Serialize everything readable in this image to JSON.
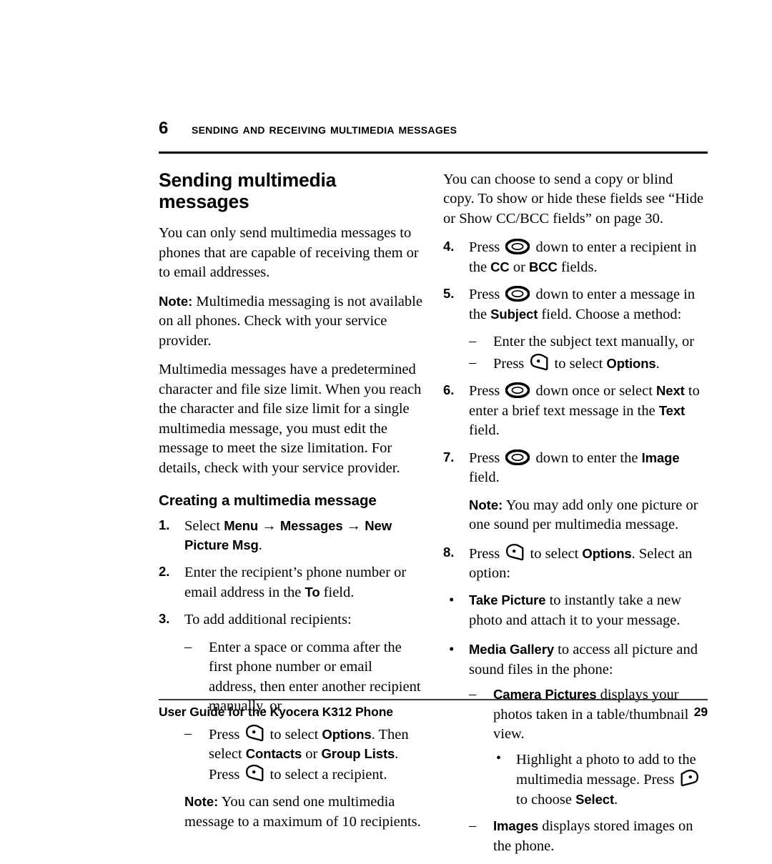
{
  "header": {
    "chapter_number": "6",
    "chapter_title": "Sending and Receiving Multimedia Messages"
  },
  "left_column": {
    "section_title": "Sending multimedia messages",
    "intro": "You can only send multimedia messages to phones that are capable of receiving them or to email addresses.",
    "note1_label": "Note:",
    "note1_text": "Multimedia messaging is not available on all phones. Check with your service provider.",
    "para2": "Multimedia messages have a predetermined character and file size limit. When you reach the character and file size limit for a single multimedia message, you must edit the message to meet the size limitation. For details, check with your service provider.",
    "subsection_title": "Creating a multimedia message",
    "step1": {
      "marker": "1.",
      "text_a": "Select ",
      "ui_menu": "Menu",
      "arrow1": " → ",
      "ui_messages": "Messages",
      "arrow2": " → ",
      "ui_newpic": "New Picture Msg",
      "text_b": "."
    },
    "step2": {
      "marker": "2.",
      "text_a": "Enter the recipient’s phone number or email address in the ",
      "ui_to": "To",
      "text_b": " field."
    },
    "step3": {
      "marker": "3.",
      "text": "To add additional recipients:"
    },
    "dash1": {
      "marker": "–",
      "text": "Enter a space or comma after the first phone number or email address, then enter another recipient manually, or"
    },
    "dash2": {
      "marker": "–",
      "text_a": "Press ",
      "icon": "left-softkey-icon",
      "text_b": " to select ",
      "ui_options": "Options",
      "text_c": ". Then select ",
      "ui_contacts": "Contacts",
      "text_d": " or ",
      "ui_grouplists": "Group Lists",
      "text_e": ". Press ",
      "icon2": "left-softkey-icon",
      "text_f": " to select a recipient."
    },
    "note2_label": "Note:",
    "note2_text": "You can send one multimedia message to a maximum of 10 recipients."
  },
  "right_column": {
    "intro": "You can choose to send a copy or blind copy. To show or hide these fields see “Hide or Show CC/BCC fields” on page 30.",
    "step4": {
      "marker": "4.",
      "text_a": "Press ",
      "icon": "navigation-key-icon",
      "text_b": " down to enter a recipient in the ",
      "ui_cc": "CC",
      "text_c": " or ",
      "ui_bcc": "BCC",
      "text_d": " fields."
    },
    "step5": {
      "marker": "5.",
      "text_a": "Press ",
      "icon": "navigation-key-icon",
      "text_b": " down to enter a message in the ",
      "ui_subject": "Subject",
      "text_c": " field. Choose a method:"
    },
    "dash5a": {
      "marker": "–",
      "text": "Enter the subject text manually, or"
    },
    "dash5b": {
      "marker": "–",
      "text_a": "Press ",
      "icon": "left-softkey-icon",
      "text_b": " to select ",
      "ui_options": "Options",
      "text_c": "."
    },
    "step6": {
      "marker": "6.",
      "text_a": "Press ",
      "icon": "navigation-key-icon",
      "text_b": " down once or select ",
      "ui_next": "Next",
      "text_c": " to enter a brief text message in the ",
      "ui_text": "Text",
      "text_d": " field."
    },
    "step7": {
      "marker": "7.",
      "text_a": "Press ",
      "icon": "navigation-key-icon",
      "text_b": " down to enter the ",
      "ui_image": "Image",
      "text_c": " field."
    },
    "note_label": "Note:",
    "note_text": "You may add only one picture or one sound per multimedia message.",
    "step8": {
      "marker": "8.",
      "text_a": "Press ",
      "icon": "left-softkey-icon",
      "text_b": " to select ",
      "ui_options": "Options",
      "text_c": ". Select an option:"
    },
    "bullet1": {
      "marker": "•",
      "ui_take_picture": "Take Picture",
      "text": " to instantly take a new photo and attach it to your message."
    },
    "bullet2": {
      "marker": "•",
      "ui_media_gallery": "Media Gallery",
      "text": " to access all picture and sound files in the phone:"
    },
    "dash_camera": {
      "marker": "–",
      "ui_camera_pictures": "Camera Pictures",
      "text": " displays your photos taken in a table/thumbnail view."
    },
    "dot_highlight": {
      "marker": "•",
      "text_a": "Highlight a photo to add to the multimedia message. Press ",
      "icon": "right-softkey-icon",
      "text_b": " to choose ",
      "ui_select": "Select",
      "text_c": "."
    },
    "dash_images": {
      "marker": "–",
      "ui_images": "Images",
      "text": " displays stored images on the phone."
    }
  },
  "footer": {
    "guide_text": "User Guide for the Kyocera K312 Phone",
    "page_number": "29"
  }
}
